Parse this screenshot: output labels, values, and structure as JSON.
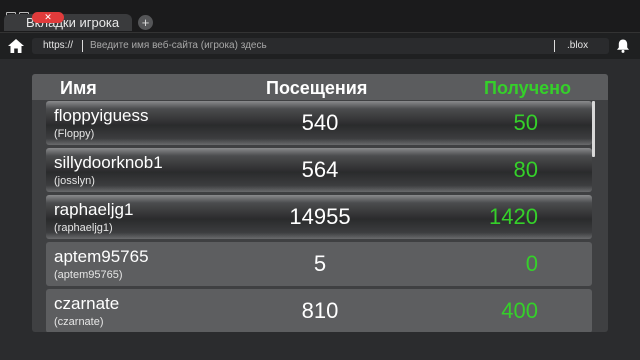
{
  "browser": {
    "tab_title": "Вкладки игрока",
    "tab_close": "✕",
    "new_tab": "+",
    "scheme": "https://",
    "address_placeholder": "Введите имя веб-сайта (игрока) здесь",
    "domain_suffix": ".blox"
  },
  "table": {
    "headers": {
      "name": "Имя",
      "visits": "Посещения",
      "received": "Получено"
    },
    "accent_color": "#35d02a",
    "rows": [
      {
        "username": "floppyiguess",
        "display": "(Floppy)",
        "visits": "540",
        "received": "50"
      },
      {
        "username": "sillydoorknob1",
        "display": "(josslyn)",
        "visits": "564",
        "received": "80"
      },
      {
        "username": "raphaeljg1",
        "display": "(raphaeljg1)",
        "visits": "14955",
        "received": "1420"
      },
      {
        "username": "aptem95765",
        "display": "(aptem95765)",
        "visits": "5",
        "received": "0"
      },
      {
        "username": "czarnate",
        "display": "(czarnate)",
        "visits": "810",
        "received": "400"
      }
    ]
  }
}
